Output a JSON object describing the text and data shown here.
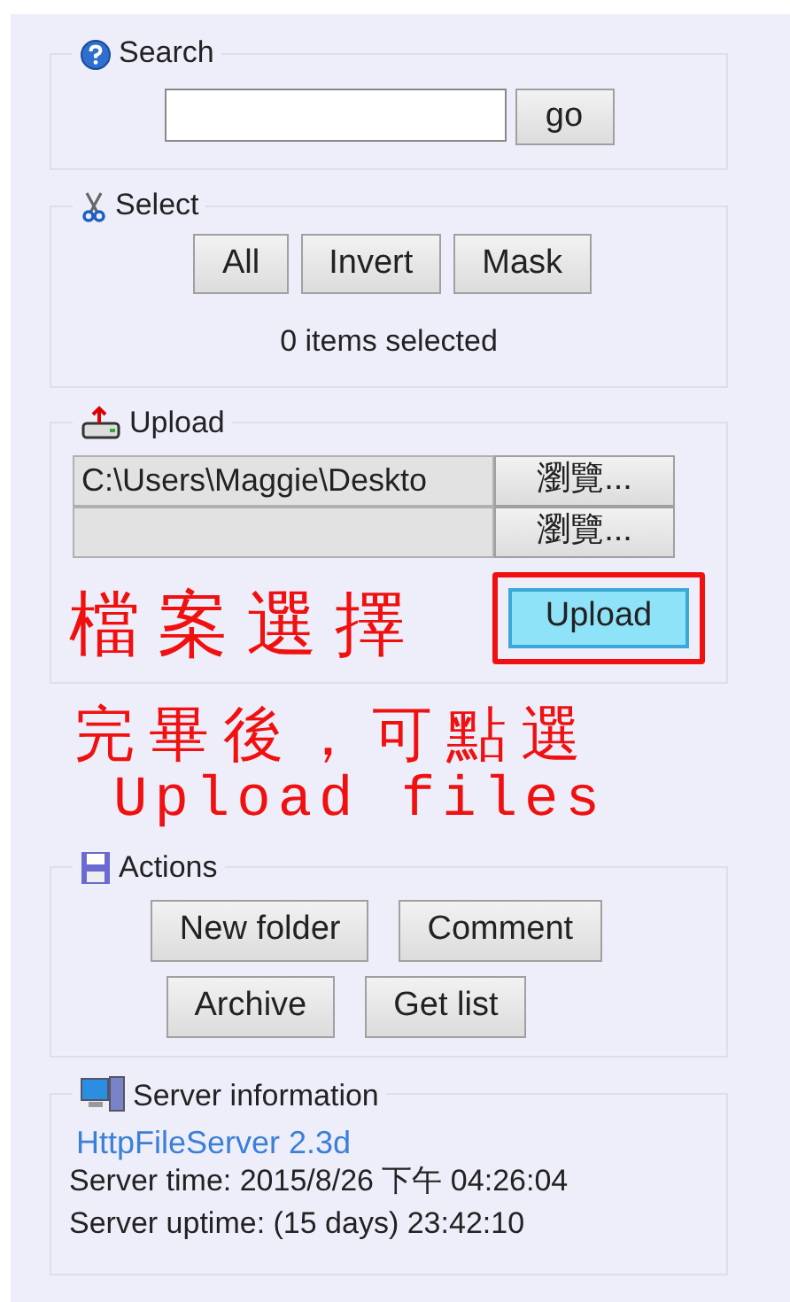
{
  "search": {
    "title": "Search",
    "button": "go"
  },
  "select": {
    "title": "Select",
    "buttons": [
      "All",
      "Invert",
      "Mask"
    ],
    "status": "0 items selected"
  },
  "upload": {
    "title": "Upload",
    "files": [
      {
        "value": "C:\\Users\\Maggie\\Deskto",
        "browse": "瀏覽..."
      },
      {
        "browse": "瀏覽..."
      }
    ],
    "button": "Upload",
    "focused": true,
    "boxed": true
  },
  "actions": {
    "title": "Actions",
    "rows": [
      [
        "New folder",
        "Comment"
      ],
      [
        "Archive",
        "Get list"
      ]
    ]
  },
  "server_info": {
    "title": "Server information",
    "link": "HttpFileServer 2.3d",
    "lines": [
      "Server time: 2015/8/26 下午 04:26:04",
      "Server uptime: (15 days) 23:42:10"
    ]
  },
  "annotation": {
    "lines": [
      "檔案選擇",
      "完畢後，可點選",
      "Upload files"
    ]
  }
}
